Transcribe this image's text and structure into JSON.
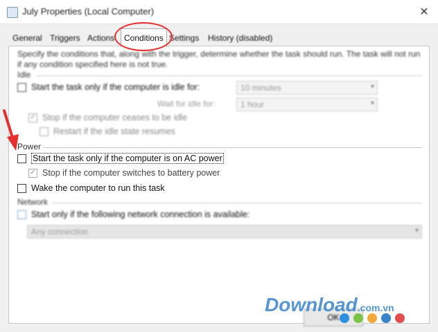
{
  "window": {
    "title": "July Properties (Local Computer)",
    "close_glyph": "✕"
  },
  "tabs": [
    {
      "label": "General"
    },
    {
      "label": "Triggers"
    },
    {
      "label": "Actions"
    },
    {
      "label": "Conditions"
    },
    {
      "label": "Settings"
    },
    {
      "label": "History (disabled)"
    }
  ],
  "description": "Specify the conditions that, along with the trigger, determine whether the task should run.  The task will not run  if any condition specified here is not true.",
  "idle": {
    "header": "Idle",
    "start_only_if_idle": {
      "label": "Start the task only if the computer is idle for:",
      "checked": false
    },
    "idle_for_value": "10 minutes",
    "wait_for_idle_label": "Wait for idle for:",
    "wait_for_idle_value": "1 hour",
    "stop_if_ceases": {
      "label": "Stop if the computer ceases to be idle",
      "checked": true
    },
    "restart_if_resumes": {
      "label": "Restart if the idle state resumes",
      "checked": false
    }
  },
  "power": {
    "header": "Power",
    "start_only_on_ac": {
      "label": "Start the task only if the computer is on AC power",
      "checked": false
    },
    "stop_on_battery": {
      "label": "Stop if the computer switches to battery power",
      "checked": true
    },
    "wake_to_run": {
      "label": "Wake the computer to run this task",
      "checked": false
    }
  },
  "network": {
    "header": "Network",
    "start_only_if_network": {
      "label": "Start only if the following network connection is available:",
      "checked": false
    },
    "connection_value": "Any connection"
  },
  "buttons": {
    "ok_label": "OK"
  },
  "watermark": {
    "brand": "Download",
    "domain": ".com.vn"
  },
  "colors": {
    "annotation_red": "#e53030",
    "watermark_blue": "#3a84c9",
    "dot_colors": [
      "#2f8fe0",
      "#7cc34a",
      "#f2a93b",
      "#3a84c9",
      "#e24d4d"
    ]
  },
  "icons": {
    "close": "close-icon",
    "app": "task-scheduler-icon",
    "checkmark": "checkmark-icon",
    "dropdown": "chevron-down-icon",
    "annotation": "red-arrow-annotation"
  }
}
